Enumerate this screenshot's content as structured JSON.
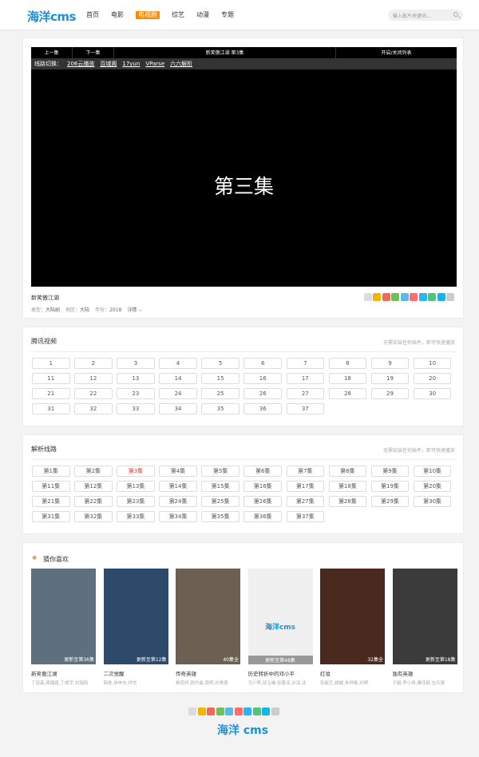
{
  "header": {
    "logo": "海洋cms",
    "nav": [
      "首页",
      "电影",
      "电视剧",
      "综艺",
      "动漫",
      "专题"
    ],
    "active_nav": "电视剧",
    "search_placeholder": "输入影片关键词..."
  },
  "player": {
    "prev": "上一集",
    "next": "下一集",
    "title_bar": "新笑傲江湖   第3集",
    "toggle_list": "开启/关闭列表",
    "line_label": "线路切换：",
    "lines": [
      "206云播放",
      "百城阁",
      "17yun",
      "VParse",
      "六六解析"
    ],
    "screen_text": "第三集"
  },
  "video": {
    "title": "新笑傲江湖",
    "meta": [
      {
        "k": "类型：",
        "v": "大陆剧"
      },
      {
        "k": "地区：",
        "v": "大陆"
      },
      {
        "k": "年份：",
        "v": "2018"
      }
    ],
    "detail": "详情 ⌵"
  },
  "share_colors": [
    "#dcdcdc",
    "#f5b400",
    "#ef6a5a",
    "#6ac259",
    "#5bb8e8",
    "#ff6d6d",
    "#2ab5f0",
    "#55c27b",
    "#13b6e6",
    "#cccccc"
  ],
  "section1": {
    "title": "腾讯视频",
    "tip": "无需安装任何插件，即可快速播放",
    "episodes": [
      "1",
      "2",
      "3",
      "4",
      "5",
      "6",
      "7",
      "8",
      "9",
      "10",
      "11",
      "12",
      "13",
      "14",
      "15",
      "16",
      "17",
      "18",
      "19",
      "20",
      "21",
      "22",
      "23",
      "24",
      "25",
      "26",
      "27",
      "28",
      "29",
      "30",
      "31",
      "32",
      "33",
      "34",
      "35",
      "36",
      "37"
    ]
  },
  "section2": {
    "title": "解析线路",
    "tip": "无需安装任何插件，即可快速播放",
    "current": "第3集",
    "episodes": [
      "第1集",
      "第2集",
      "第3集",
      "第4集",
      "第5集",
      "第6集",
      "第7集",
      "第8集",
      "第9集",
      "第10集",
      "第11集",
      "第12集",
      "第13集",
      "第14集",
      "第15集",
      "第16集",
      "第17集",
      "第18集",
      "第19集",
      "第20集",
      "第21集",
      "第22集",
      "第23集",
      "第24集",
      "第25集",
      "第26集",
      "第27集",
      "第28集",
      "第29集",
      "第30集",
      "第31集",
      "第32集",
      "第33集",
      "第34集",
      "第35集",
      "第36集",
      "第37集"
    ]
  },
  "likes": {
    "title": "猜你喜欢",
    "items": [
      {
        "name": "新笑傲江湖",
        "cast": "丁冠森,蒋璐霞,丁威宇,刘瑞阳",
        "badge": "更新至第36集",
        "bg": "#5e6f7e"
      },
      {
        "name": "二次觉醒",
        "cast": "韩栋,徐申东,柯言",
        "badge": "更新至第12集",
        "bg": "#2e4a6b"
      },
      {
        "name": "传奇英雄",
        "cast": "杨蕊妤,颜丹晨,周明,孙常恩",
        "badge": "40集全",
        "bg": "#6b6052"
      },
      {
        "name": "历史转折中的邓小平",
        "cast": "马少骅,邵玉峰,张嘉译,孙淳,沈",
        "badge": "更新至第48集",
        "bg": "#f0f0f0",
        "placeholder": "海洋cms"
      },
      {
        "name": "红妆",
        "cast": "张歆艺,颖媛,朱坤俊,刘婷",
        "badge": "32集全",
        "bg": "#4a2a1e"
      },
      {
        "name": "独有英雄",
        "cast": "于越,李小冉,滕佳颖,包天斐",
        "badge": "更新至第18集",
        "bg": "#3b3b3b"
      }
    ]
  },
  "footer": {
    "logo": "海洋 cms"
  }
}
